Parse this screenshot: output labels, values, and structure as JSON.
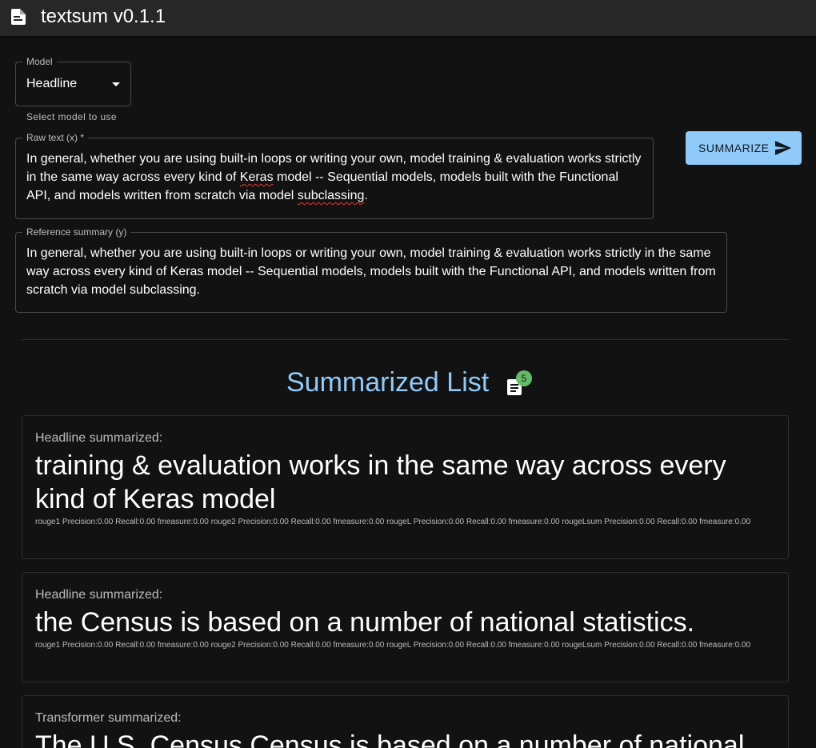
{
  "app": {
    "title": "textsum v0.1.1"
  },
  "model_select": {
    "label": "Model",
    "value": "Headline",
    "helper": "Select model to use"
  },
  "raw_text": {
    "label": "Raw text (x) *",
    "segments": [
      "In general, whether you are using built-in loops or writing your own, model training & evaluation works strictly in the same way across every kind of ",
      "Keras",
      " model -- Sequential models, models built with the Functional API, and models written from scratch via model ",
      "subclassing",
      "."
    ]
  },
  "reference": {
    "label": "Reference summary (y)",
    "value": "In general, whether you are using built-in loops or writing your own, model training & evaluation works strictly in the same way across every kind of Keras model -- Sequential models, models built with the Functional API, and models written from scratch via model subclassing."
  },
  "summarize_button": {
    "label": "SUMMARIZE",
    "icon": "send-icon"
  },
  "list": {
    "title": "Summarized List",
    "icon": "note-icon",
    "badge": "5"
  },
  "cards": [
    {
      "model": "Headline summarized:",
      "summary": "training & evaluation works in the same way across every kind of Keras model",
      "scores": "rouge1 Precision:0.00 Recall:0.00 fmeasure:0.00 rouge2 Precision:0.00 Recall:0.00 fmeasure:0.00 rougeL Precision:0.00 Recall:0.00 fmeasure:0.00 rougeLsum Precision:0.00 Recall:0.00 fmeasure:0.00"
    },
    {
      "model": "Headline summarized:",
      "summary": "the Census is based on a number of national statistics.",
      "scores": "rouge1 Precision:0.00 Recall:0.00 fmeasure:0.00 rouge2 Precision:0.00 Recall:0.00 fmeasure:0.00 rougeL Precision:0.00 Recall:0.00 fmeasure:0.00 rougeLsum Precision:0.00 Recall:0.00 fmeasure:0.00"
    },
    {
      "model": "Transformer summarized:",
      "summary": "The U.S. Census Census is based on a number of national"
    }
  ],
  "colors": {
    "accent": "#90caf9",
    "badge": "#66bb6a",
    "background": "#121212",
    "appbar": "#272727"
  }
}
